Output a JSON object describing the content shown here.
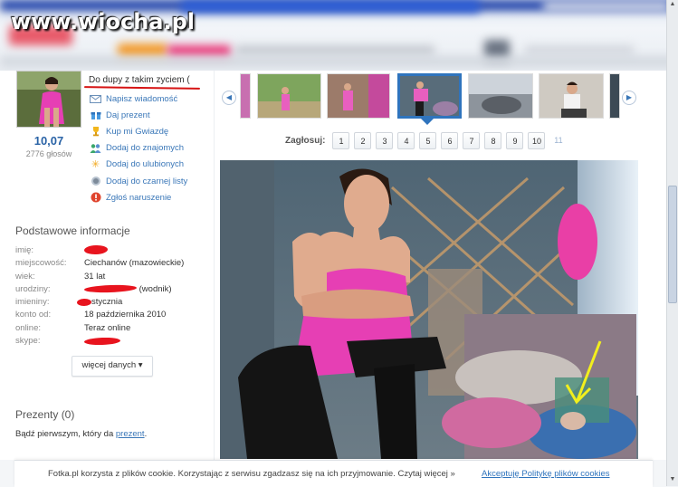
{
  "watermark": "www.wiocha.pl",
  "profile": {
    "status_text": "Do dupy z takim zyciem (",
    "rating": "10,07",
    "votes": "2776 głosów",
    "actions": [
      {
        "label": "Napisz wiadomość",
        "icon": "envelope-icon"
      },
      {
        "label": "Daj prezent",
        "icon": "gift-icon"
      },
      {
        "label": "Kup mi Gwiazdę",
        "icon": "trophy-icon"
      },
      {
        "label": "Dodaj do znajomych",
        "icon": "people-icon"
      },
      {
        "label": "Dodaj do ulubionych",
        "icon": "star-icon"
      },
      {
        "label": "Dodaj do czarnej listy",
        "icon": "blacklist-icon"
      },
      {
        "label": "Zgłoś naruszenie",
        "icon": "warning-icon"
      }
    ]
  },
  "basic_info": {
    "title": "Podstawowe informacje",
    "rows": [
      {
        "label": "imię:",
        "value": ""
      },
      {
        "label": "miejscowość:",
        "value": "Ciechanów (mazowieckie)"
      },
      {
        "label": "wiek:",
        "value": "31 lat"
      },
      {
        "label": "urodziny:",
        "value": "(wodnik)"
      },
      {
        "label": "imieniny:",
        "value": "stycznia"
      },
      {
        "label": "konto od:",
        "value": "18 października 2010"
      },
      {
        "label": "online:",
        "value": "Teraz online"
      },
      {
        "label": "skype:",
        "value": ""
      }
    ],
    "more_button": "więcej danych ▾"
  },
  "gifts": {
    "title": "Prezenty (0)",
    "text_before": "Bądź pierwszym, który da ",
    "link": "prezent",
    "text_after": "."
  },
  "voting": {
    "label": "Zagłosuj:",
    "options": [
      "1",
      "2",
      "3",
      "4",
      "5",
      "6",
      "7",
      "8",
      "9",
      "10",
      "11"
    ]
  },
  "cookie_bar": {
    "text": "Fotka.pl korzysta z plików cookie. Korzystając z serwisu zgadzasz się na ich przyjmowanie. Czytaj więcej »",
    "accept_link": "Akceptuję Politykę plików cookies"
  },
  "colors": {
    "accent": "#2f74bd",
    "link": "#3a77b8",
    "redaction": "#e8141e",
    "highlight_arrow": "#f2ef1d",
    "dress_pink": "#e63fb4"
  }
}
